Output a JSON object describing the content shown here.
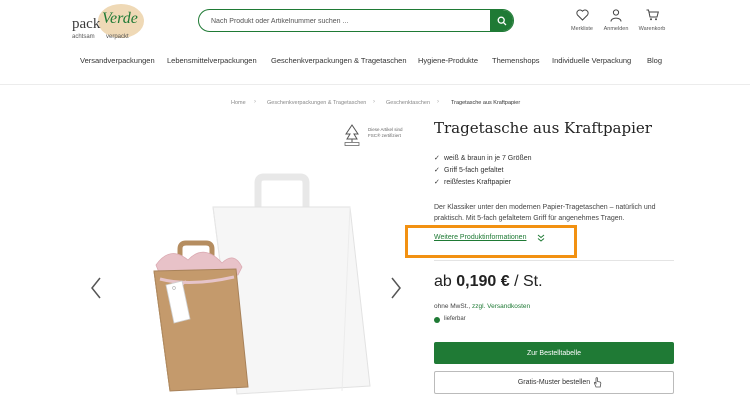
{
  "logo": {
    "word1": "pack",
    "word2": "Verde",
    "tagline1": "achtsam",
    "tagline2": "verpackt"
  },
  "search": {
    "placeholder": "Nach Produkt oder Artikelnummer suchen ..."
  },
  "header_icons": {
    "wishlist": {
      "label": "Merkliste",
      "icon": "heart-icon"
    },
    "account": {
      "label": "Anmelden",
      "icon": "user-icon"
    },
    "cart": {
      "label": "Warenkorb",
      "icon": "cart-icon"
    }
  },
  "nav": [
    "Versandverpackungen",
    "Lebensmittelverpackungen",
    "Geschenkverpackungen & Tragetaschen",
    "Hygiene-Produkte",
    "Themenshops",
    "Individuelle Verpackung",
    "Blog"
  ],
  "breadcrumb": [
    "Home",
    "Geschenkverpackungen & Tragetaschen",
    "Geschenktaschen",
    "Tragetasche aus Kraftpapier"
  ],
  "gallery": {
    "fsc_note": "Diese Artikel sind FSC® zertifiziert"
  },
  "product": {
    "title": "Tragetasche aus Kraftpapier",
    "features": [
      "weiß & braun in je 7 Größen",
      "Griff 5-fach gefaltet",
      "reißfestes Kraftpapier"
    ],
    "description": "Der Klassiker unter den modernen Papier-Tragetaschen – natürlich und praktisch. Mit 5-fach gefaltetem Griff für angenehmes Tragen.",
    "more_info": "Weitere Produktinformationen",
    "price_prefix": "ab",
    "price_value": "0,190 €",
    "price_unit": "/ St.",
    "tax_text": "ohne MwSt.,",
    "shipping_link": "zzgl. Versandkosten",
    "availability": "lieferbar",
    "primary_button": "Zur Bestelltabelle",
    "secondary_button": "Gratis-Muster bestellen"
  },
  "colors": {
    "brand_green": "#1f7a35",
    "highlight_orange": "#f29111"
  }
}
